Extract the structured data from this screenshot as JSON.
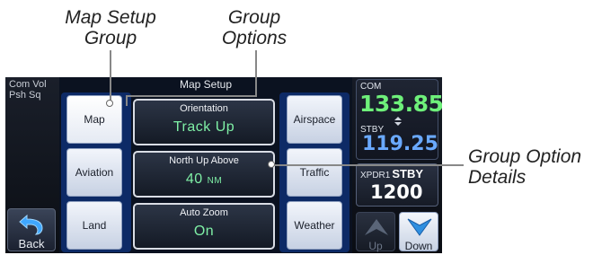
{
  "callouts": {
    "map_setup_group": [
      "Map Setup",
      "Group"
    ],
    "group_options": [
      "Group",
      "Options"
    ],
    "group_option_details": [
      "Group Option",
      "Details"
    ]
  },
  "screen": {
    "side": {
      "comvol_line1": "Com Vol",
      "comvol_line2": "Psh Sq",
      "back_label": "Back",
      "back_icon": "back-arrow-icon"
    },
    "title": "Map Setup",
    "tabs_left": [
      {
        "label": "Map",
        "selected": true
      },
      {
        "label": "Aviation",
        "selected": false
      },
      {
        "label": "Land",
        "selected": false
      }
    ],
    "tabs_right": [
      {
        "label": "Airspace"
      },
      {
        "label": "Traffic"
      },
      {
        "label": "Weather"
      }
    ],
    "options": [
      {
        "title": "Orientation",
        "value": "Track Up",
        "unit": ""
      },
      {
        "title": "North Up Above",
        "value": "40",
        "unit": "NM"
      },
      {
        "title": "Auto Zoom",
        "value": "On",
        "unit": ""
      }
    ],
    "radio": {
      "com_label": "COM",
      "com_active": "133.85",
      "swap_icon": "swap-arrows-icon",
      "stby_label": "STBY",
      "com_standby": "119.25",
      "xpdr_label": "XPDR1",
      "xpdr_mode": "STBY",
      "xpdr_code": "1200"
    },
    "nav": {
      "up_label": "Up",
      "down_label": "Down",
      "up_icon": "up-arrow-icon",
      "down_icon": "down-arrow-icon"
    },
    "colors": {
      "active_freq": "#6ef07a",
      "standby_freq": "#6aa9ff",
      "option_value": "#7ff0a6",
      "tab_slot": "#0d2a66"
    }
  }
}
